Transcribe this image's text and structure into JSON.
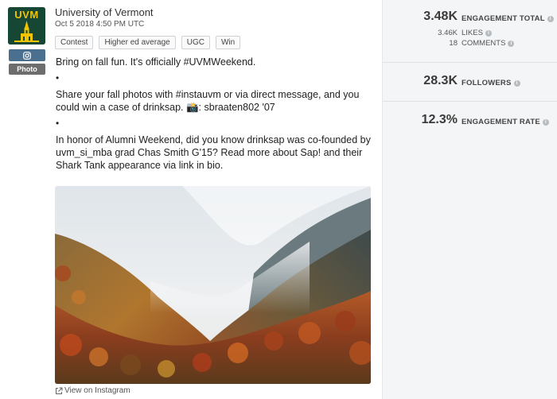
{
  "post": {
    "account_name": "University of Vermont",
    "date": "Oct 5 2018 4:50 PM UTC",
    "logo_text": "UVM",
    "network_icon": "instagram-icon",
    "type_badge": "Photo",
    "tags": [
      "Contest",
      "Higher ed average",
      "UGC",
      "Win"
    ],
    "caption": {
      "line1": "Bring on fall fun. It's officially #UVMWeekend.",
      "sep1": "•",
      "line2": "Share your fall photos with #instauvm or via direct message, and you could win a case of drinksap. 📸: sbraaten802 '07",
      "sep2": "•",
      "line3": "In honor of Alumni Weekend, did you know drinksap was co-founded by uvm_si_mba grad Chas Smith G'15? Read more about Sap! and their Shark Tank appearance via link in bio."
    },
    "view_link": "View on Instagram"
  },
  "metrics": {
    "engagement_total": {
      "value": "3.48K",
      "label": "ENGAGEMENT TOTAL"
    },
    "likes": {
      "value": "3.46K",
      "label": "LIKES"
    },
    "comments": {
      "value": "18",
      "label": "COMMENTS"
    },
    "followers": {
      "value": "28.3K",
      "label": "FOLLOWERS"
    },
    "engagement_rate": {
      "value": "12.3%",
      "label": "ENGAGEMENT RATE"
    }
  },
  "colors": {
    "uvm_green": "#154734",
    "uvm_gold": "#f2c300",
    "instagram_button": "#4a6f8f"
  }
}
